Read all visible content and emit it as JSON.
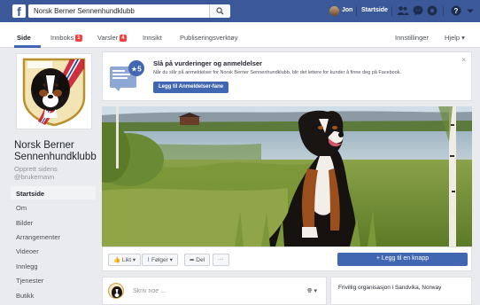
{
  "topbar": {
    "logo": "f",
    "search_value": "Norsk Berner Sennenhundklubb",
    "user_name": "Jon",
    "home_label": "Startside",
    "icons": [
      "friends-icon",
      "messages-icon",
      "notifications-icon",
      "help-icon",
      "dropdown-icon"
    ]
  },
  "page_nav": {
    "items": [
      {
        "label": "Side"
      },
      {
        "label": "Innboks",
        "badge": "1"
      },
      {
        "label": "Varsler",
        "badge": "4"
      },
      {
        "label": "Innsikt"
      },
      {
        "label": "Publiseringsverktøy"
      }
    ],
    "right": [
      {
        "label": "Innstillinger"
      },
      {
        "label": "Hjelp ▾"
      }
    ]
  },
  "sidebar": {
    "page_name": "Norsk Berner Sennenhundklubb",
    "handle_line1": "Opprett sidens",
    "handle_line2": "@brukernavn",
    "items": [
      {
        "label": "Startside"
      },
      {
        "label": "Om"
      },
      {
        "label": "Bilder"
      },
      {
        "label": "Arrangementer"
      },
      {
        "label": "Videoer"
      },
      {
        "label": "Innlegg"
      },
      {
        "label": "Tjenester"
      },
      {
        "label": "Butikk"
      }
    ]
  },
  "promo": {
    "title": "Slå på vurderinger og anmeldelser",
    "text": "Når du slår på anmeldelser for Norsk Berner Sennenhundklubb, blir det lettere for kunder å finne deg på Facebook.",
    "button": "Legg til Anmeldelser-fane",
    "close": "×"
  },
  "actions": {
    "like": "Likt ▾",
    "follow": "Følger ▾",
    "share": "Del",
    "more": "···",
    "cta": "+ Legg til en knapp"
  },
  "composer": {
    "placeholder": "Skriv noe ...",
    "audience": "▾"
  },
  "info": {
    "category": "Frivillig organisasjon i Sandvika, Norway"
  },
  "colors": {
    "brand": "#3b5998",
    "button": "#4267b2",
    "badge": "#fa3e3e"
  }
}
